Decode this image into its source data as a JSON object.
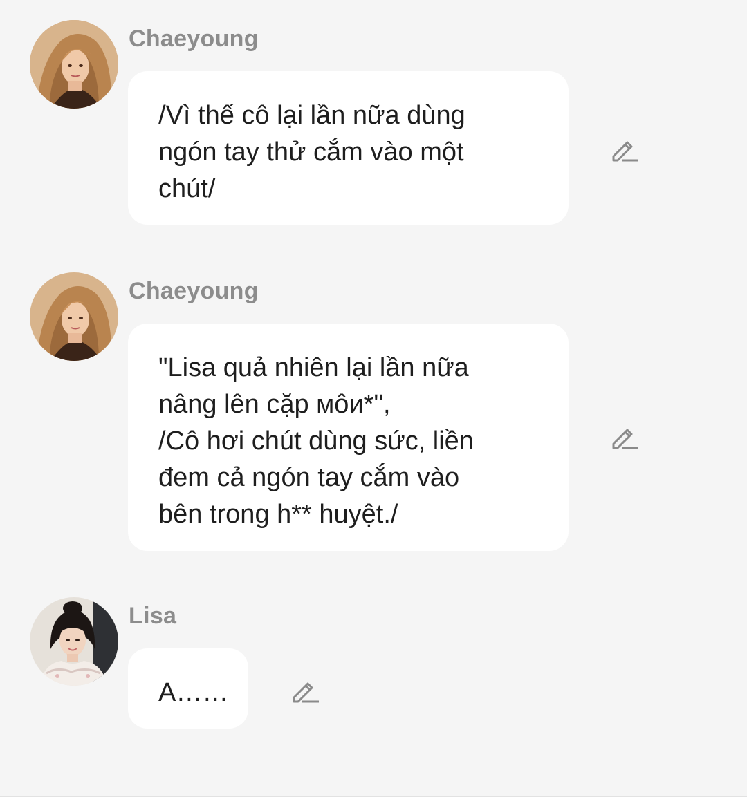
{
  "messages": [
    {
      "sender": "Chaeyoung",
      "avatar": "avatar-chaeyoung",
      "text": "/Vì thế cô lại lần nữa dùng\nngón tay thử cắm vào một\nchút/"
    },
    {
      "sender": "Chaeyoung",
      "avatar": "avatar-chaeyoung",
      "text": "\"Lisa quả nhiên lại lần nữa\nnâng lên cặp мôи*\",\n/Cô hơi chút dùng sức, liền\nđem cả ngón tay cắm vào\nbên trong h** huyệt./"
    },
    {
      "sender": "Lisa",
      "avatar": "avatar-lisa",
      "text": "A……"
    }
  ],
  "icons": {
    "edit": "pencil-edit-icon"
  },
  "colors": {
    "background": "#f5f5f5",
    "bubble": "#ffffff",
    "sender_name": "#8c8c8c",
    "text": "#1e1e1e",
    "icon": "#8a8a8a"
  }
}
